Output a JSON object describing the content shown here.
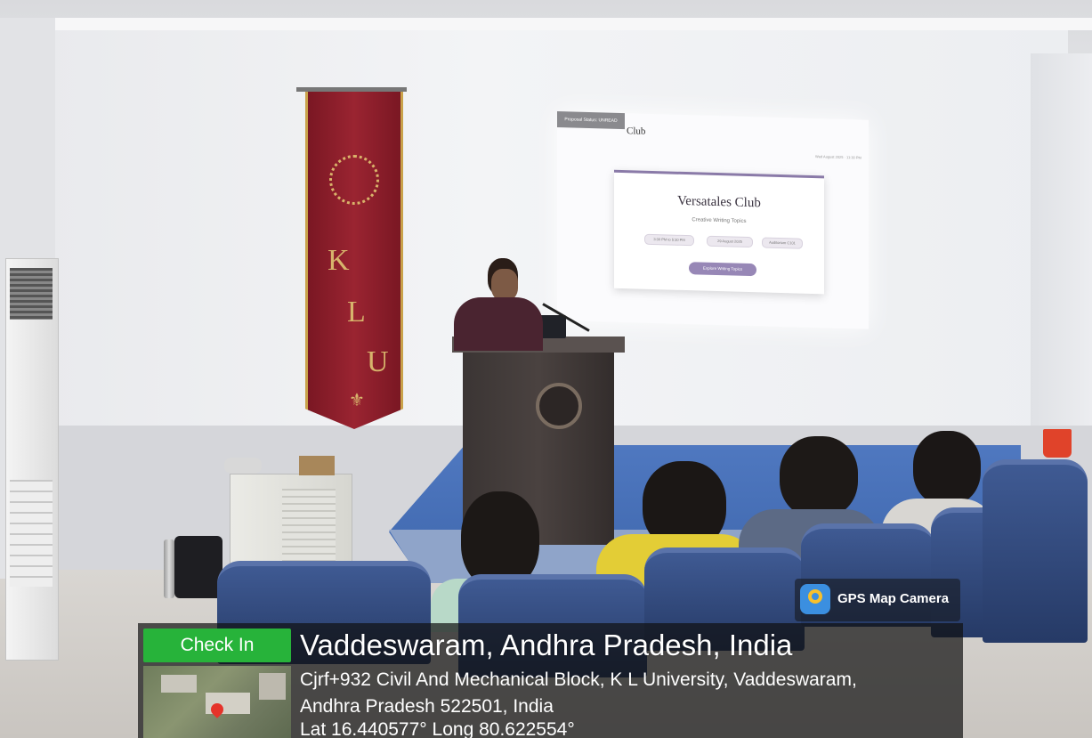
{
  "slide": {
    "header_tab": "Proposal Status: UNREAD",
    "header_brand": "Club",
    "header_right": "Wed August 2025 · 11:30 PM",
    "title": "Versatales Club",
    "subtitle": "Creative Writing Topics",
    "chips": [
      "3:30 PM to 5:30 PM",
      "29 August 2025",
      "Auditorium C101"
    ],
    "button": "Explore Writing Topics"
  },
  "banner": {
    "letters": [
      "K",
      "L",
      "U"
    ],
    "color": "#8e1e2a"
  },
  "overlay": {
    "app_name": "GPS Map Camera",
    "check_in_label": "Check In",
    "location_title": "Vaddeswaram, Andhra Pradesh, India",
    "address_line1": "Cjrf+932 Civil And Mechanical Block, K L University, Vaddeswaram,",
    "address_line2": "Andhra Pradesh 522501, India",
    "coords": "Lat 16.440577° Long 80.622554°",
    "check_in_color": "#27b33a"
  }
}
